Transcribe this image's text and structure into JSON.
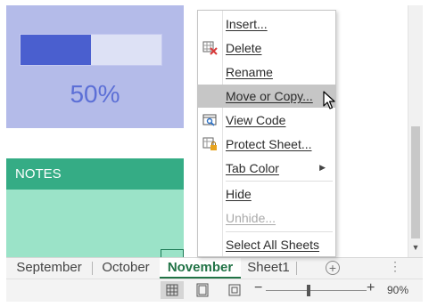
{
  "sheet": {
    "progress": {
      "value": 0.5,
      "label": "50%"
    },
    "notes_title": "NOTES"
  },
  "context_menu": {
    "items": [
      {
        "label": "Insert...",
        "icon": null,
        "disabled": false
      },
      {
        "label": "Delete",
        "icon": "delete-sheet-icon",
        "disabled": false
      },
      {
        "label": "Rename",
        "icon": null,
        "disabled": false
      },
      {
        "label": "Move or Copy...",
        "icon": null,
        "disabled": false,
        "highlighted": true
      },
      {
        "label": "View Code",
        "icon": "view-code-icon",
        "disabled": false
      },
      {
        "label": "Protect Sheet...",
        "icon": "protect-sheet-icon",
        "disabled": false
      },
      {
        "label": "Tab Color",
        "icon": null,
        "disabled": false,
        "submenu": true
      },
      {
        "label": "Hide",
        "icon": null,
        "disabled": false
      },
      {
        "label": "Unhide...",
        "icon": null,
        "disabled": true
      },
      {
        "label": "Select All Sheets",
        "icon": null,
        "disabled": false
      }
    ]
  },
  "tabs": [
    {
      "label": "September",
      "active": false
    },
    {
      "label": "October",
      "active": false
    },
    {
      "label": "November",
      "active": true
    },
    {
      "label": "Sheet1",
      "active": false
    }
  ],
  "tabbar": {
    "add_symbol": "+",
    "more_symbol": "⋮"
  },
  "statusbar": {
    "zoom_out_symbol": "−",
    "zoom_in_symbol": "+",
    "zoom_level": "90%",
    "zoom_value": 0.9
  },
  "colors": {
    "progress_panel": "#b4bbe9",
    "progress_fill": "#4a5fcf",
    "notes_header": "#35ac85",
    "notes_body": "#9be3c8",
    "active_tab_text": "#217346",
    "menu_highlight": "#c6c6c6"
  }
}
